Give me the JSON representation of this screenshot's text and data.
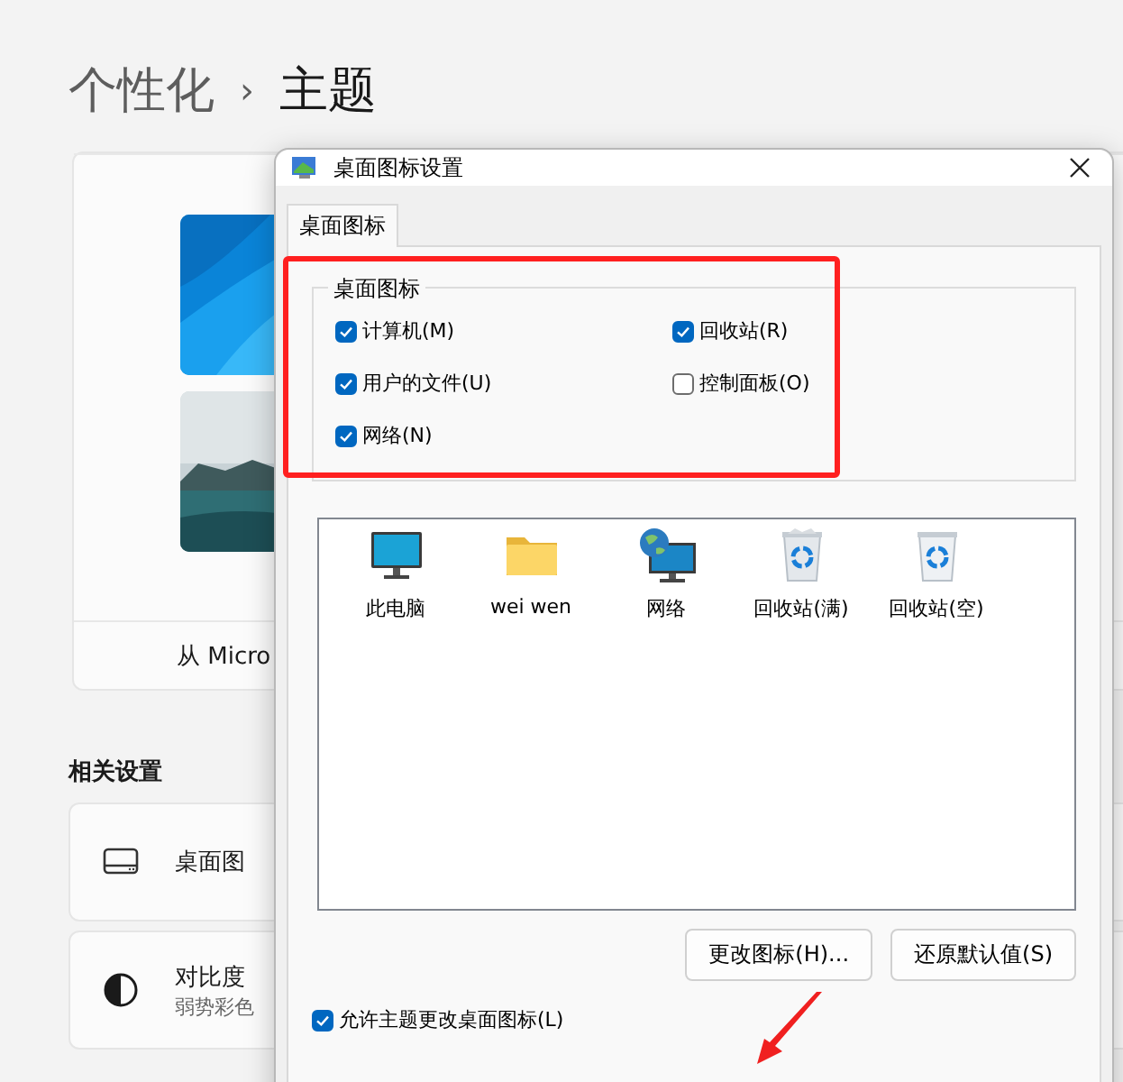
{
  "page": {
    "breadcrumb": [
      {
        "text": "个性化",
        "current": false
      },
      {
        "text": "主题",
        "current": true
      }
    ],
    "separator": "›",
    "themes_card": {
      "link": "从 Micro"
    },
    "related_title": "相关设置",
    "related": [
      {
        "kind": "desktop",
        "title": "桌面图"
      },
      {
        "kind": "contrast",
        "title": "对比度",
        "subtitle": "弱势彩色"
      }
    ]
  },
  "dialog": {
    "title": "桌面图标设置",
    "tabs": [
      {
        "label": "桌面图标",
        "selected": true
      }
    ],
    "group": {
      "title": "桌面图标",
      "checkboxes": [
        {
          "label": "计算机(M)",
          "checked": true
        },
        {
          "label": "回收站(R)",
          "checked": true
        },
        {
          "label": "用户的文件(U)",
          "checked": true
        },
        {
          "label": "控制面板(O)",
          "checked": false
        },
        {
          "label": "网络(N)",
          "checked": true
        }
      ]
    },
    "icons": [
      {
        "kind": "computer",
        "label": "此电脑"
      },
      {
        "kind": "folder",
        "label": "wei wen"
      },
      {
        "kind": "network",
        "label": "网络"
      },
      {
        "kind": "recycle-full",
        "label": "回收站(满)"
      },
      {
        "kind": "recycle-empty",
        "label": "回收站(空)"
      }
    ],
    "buttons": [
      "更改图标(H)...",
      "还原默认值(S)"
    ],
    "allow_themes": {
      "label": "允许主题更改桌面图标(L)",
      "checked": true
    }
  },
  "annotations": {
    "highlight_box": true,
    "arrow": true
  }
}
